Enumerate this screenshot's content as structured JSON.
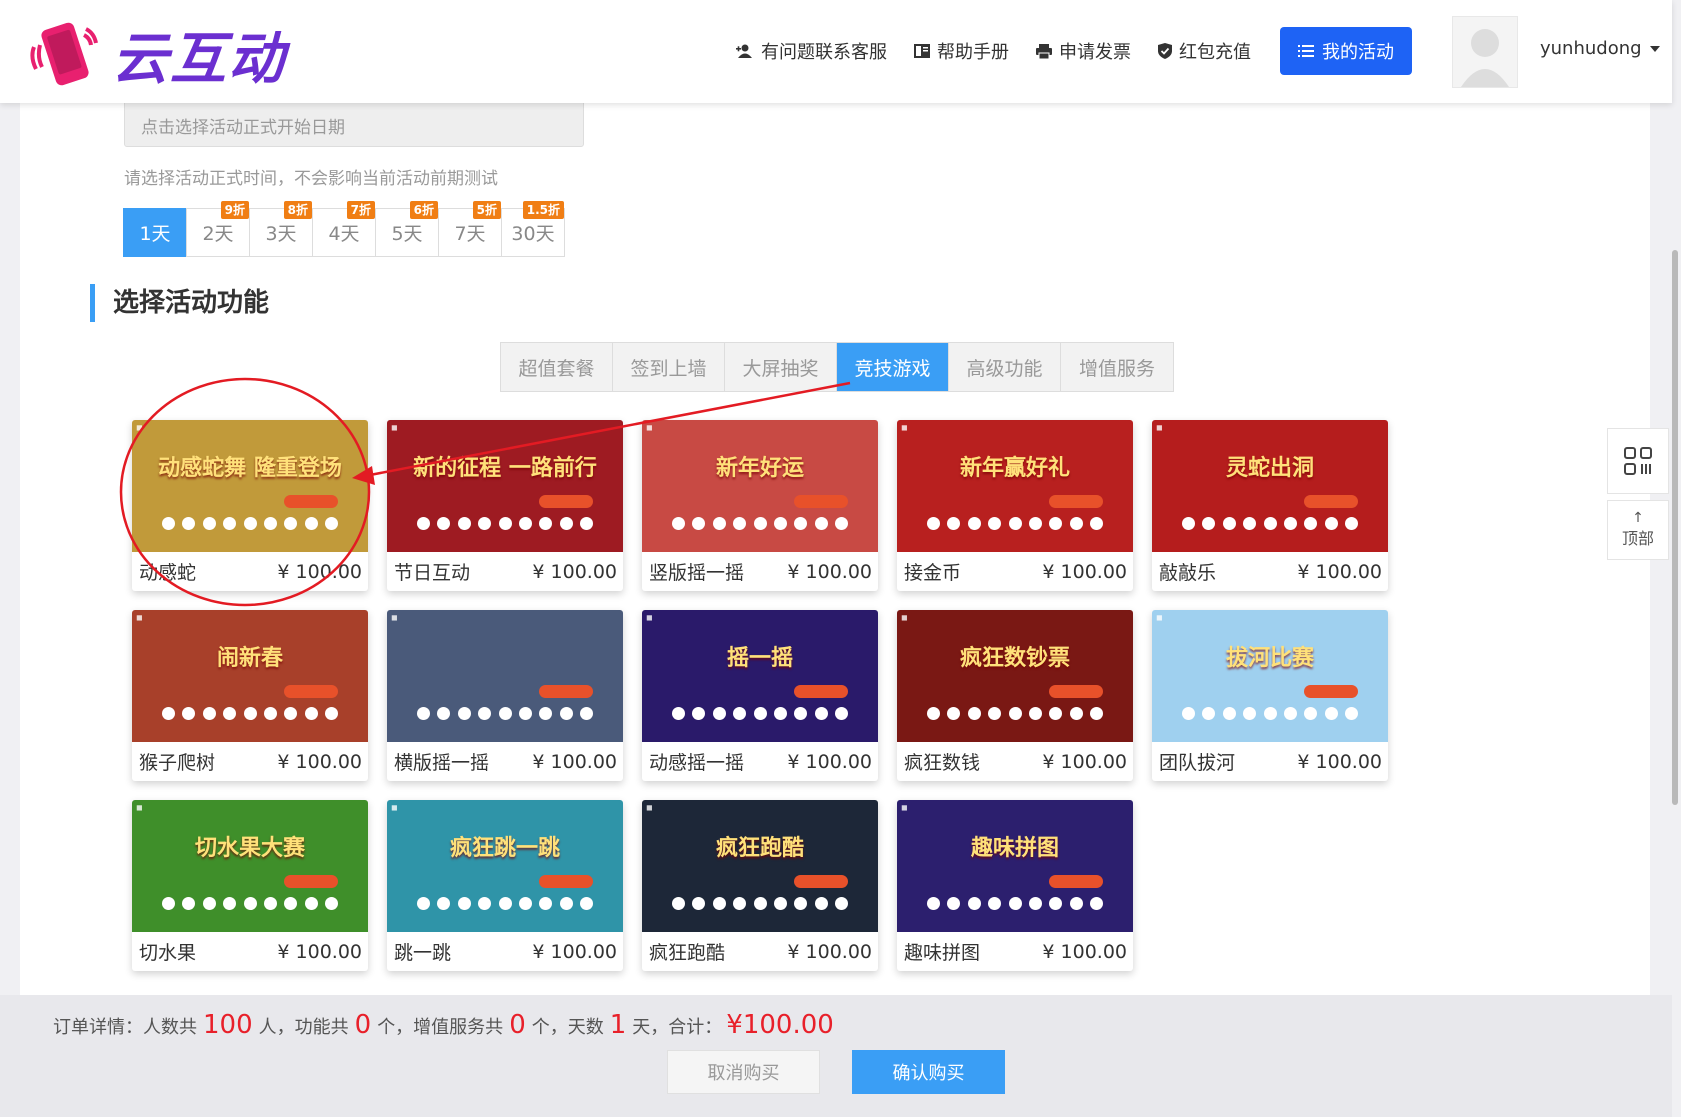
{
  "header": {
    "logo_text": "云互动",
    "nav": [
      {
        "label": "有问题联系客服",
        "icon": "add-user-icon"
      },
      {
        "label": "帮助手册",
        "icon": "book-icon"
      },
      {
        "label": "申请发票",
        "icon": "printer-icon"
      },
      {
        "label": "红包充值",
        "icon": "shield-check-icon"
      }
    ],
    "my_activity": "我的活动",
    "username": "yunhudong"
  },
  "date": {
    "placeholder": "点击选择活动正式开始日期",
    "hint": "请选择活动正式时间，不会影响当前活动前期测试",
    "days": [
      {
        "label": "1天",
        "discount": ""
      },
      {
        "label": "2天",
        "discount": "9折"
      },
      {
        "label": "3天",
        "discount": "8折"
      },
      {
        "label": "4天",
        "discount": "7折"
      },
      {
        "label": "5天",
        "discount": "6折"
      },
      {
        "label": "7天",
        "discount": "5折"
      },
      {
        "label": "30天",
        "discount": "1.5折"
      }
    ],
    "selected": "1天"
  },
  "section_title": "选择活动功能",
  "tabs": [
    "超值套餐",
    "签到上墙",
    "大屏抽奖",
    "竞技游戏",
    "高级功能",
    "增值服务"
  ],
  "active_tab": "竞技游戏",
  "games": [
    {
      "name": "动感蛇",
      "price": "¥ 100.00",
      "thumb_title": "动感蛇舞 隆重登场",
      "bg": "#c19a3a"
    },
    {
      "name": "节日互动",
      "price": "¥ 100.00",
      "thumb_title": "新的征程 一路前行",
      "bg": "#9e1b22"
    },
    {
      "name": "竖版摇一摇",
      "price": "¥ 100.00",
      "thumb_title": "新年好运",
      "bg": "#c84a44"
    },
    {
      "name": "接金币",
      "price": "¥ 100.00",
      "thumb_title": "新年赢好礼",
      "bg": "#b8201f"
    },
    {
      "name": "敲敲乐",
      "price": "¥ 100.00",
      "thumb_title": "灵蛇出洞",
      "bg": "#b51d1d"
    },
    {
      "name": "猴子爬树",
      "price": "¥ 100.00",
      "thumb_title": "闹新春",
      "bg": "#a8402a"
    },
    {
      "name": "横版摇一摇",
      "price": "¥ 100.00",
      "thumb_title": "",
      "bg": "#4a5a7a"
    },
    {
      "name": "动感摇一摇",
      "price": "¥ 100.00",
      "thumb_title": "摇一摇",
      "bg": "#2a1a6a"
    },
    {
      "name": "疯狂数钱",
      "price": "¥ 100.00",
      "thumb_title": "疯狂数钞票",
      "bg": "#7a1814"
    },
    {
      "name": "团队拔河",
      "price": "¥ 100.00",
      "thumb_title": "拔河比赛",
      "bg": "#9fd0ef"
    },
    {
      "name": "切水果",
      "price": "¥ 100.00",
      "thumb_title": "切水果大赛",
      "bg": "#3f8f2a"
    },
    {
      "name": "跳一跳",
      "price": "¥ 100.00",
      "thumb_title": "疯狂跳一跳",
      "bg": "#2f94a8"
    },
    {
      "name": "疯狂跑酷",
      "price": "¥ 100.00",
      "thumb_title": "疯狂跑酷",
      "bg": "#1d2738"
    },
    {
      "name": "趣味拼图",
      "price": "¥ 100.00",
      "thumb_title": "趣味拼图",
      "bg": "#2c1f6e"
    }
  ],
  "side": {
    "qr_icon": "qrcode-icon",
    "top_label": "顶部"
  },
  "footer": {
    "prefix": "订单详情：人数共",
    "people": "100",
    "people_unit": "人，功能共",
    "features": "0",
    "features_unit": "个，增值服务共",
    "services": "0",
    "services_unit": "个，天数",
    "days": "1",
    "days_unit": "天，合计：",
    "total": "¥100.00",
    "cancel": "取消购买",
    "confirm": "确认购买"
  },
  "colors": {
    "primary": "#3a9ef5",
    "nav_button": "#1e63f5",
    "accent_red": "#e8202a",
    "discount": "#f07e14"
  }
}
